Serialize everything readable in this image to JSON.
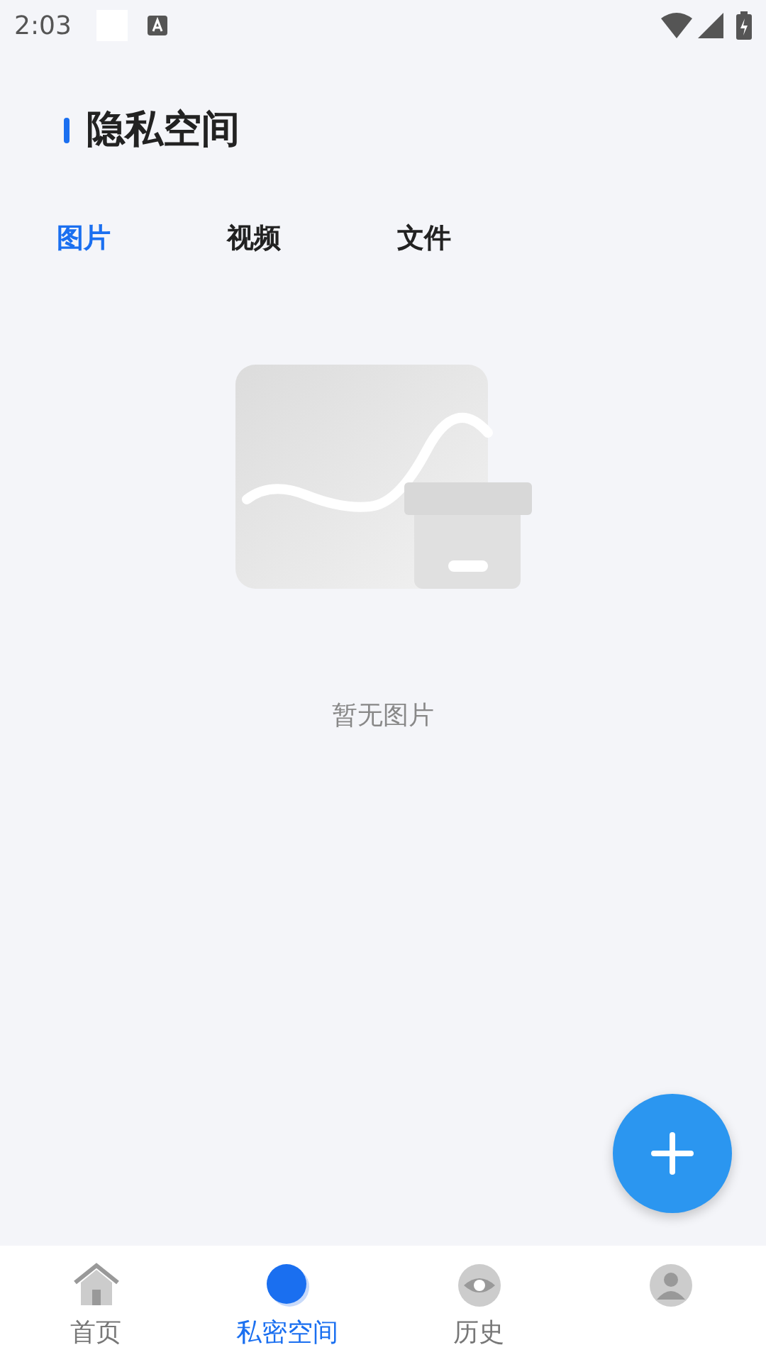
{
  "status_bar": {
    "time": "2:03"
  },
  "page_title": "隐私空间",
  "tabs": [
    {
      "label": "图片",
      "selected": true
    },
    {
      "label": "视频",
      "selected": false
    },
    {
      "label": "文件",
      "selected": false
    }
  ],
  "empty_state": {
    "message": "暂无图片"
  },
  "bottom_nav": [
    {
      "kind": "home",
      "label": "首页",
      "selected": false
    },
    {
      "kind": "private",
      "label": "私密空间",
      "selected": true
    },
    {
      "kind": "history",
      "label": "历史",
      "selected": false
    },
    {
      "kind": "profile",
      "selected": false
    }
  ]
}
